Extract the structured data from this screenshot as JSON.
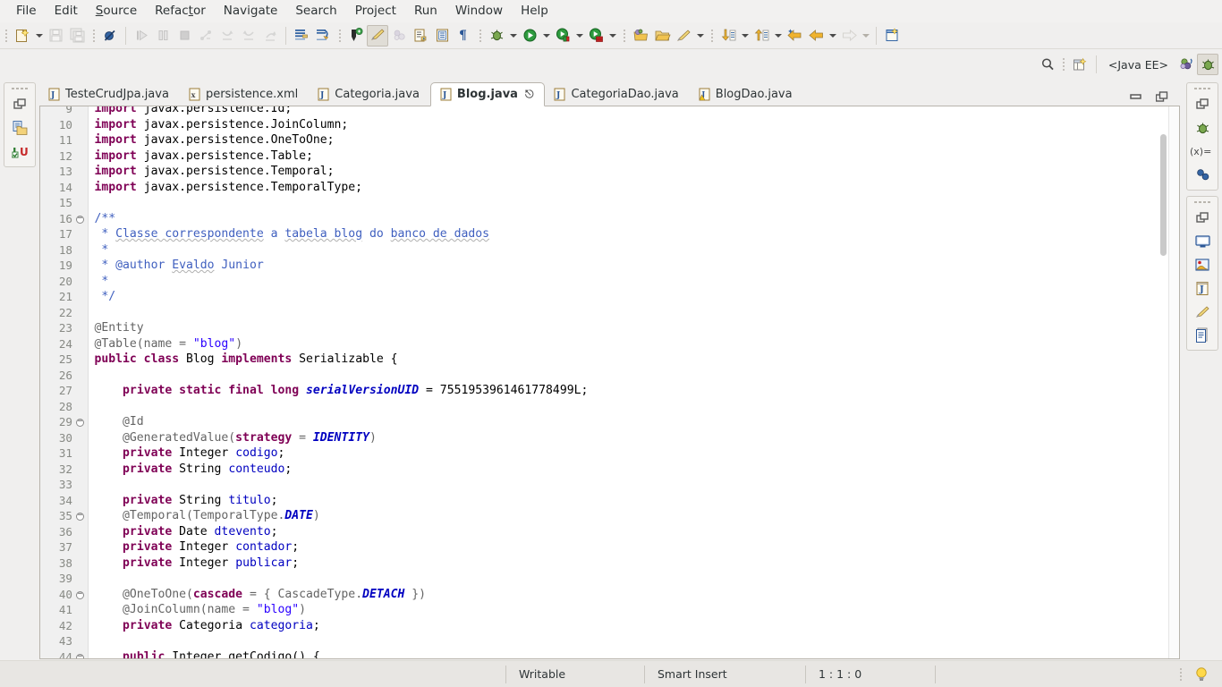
{
  "app": {
    "perspective_label": "<Java EE>",
    "accent_blue": "#2a00ff",
    "keyword_color": "#7f0055",
    "comment_color": "#3f5fbf",
    "field_color": "#0000c0",
    "annotation_color": "#646464"
  },
  "menubar": {
    "items": [
      {
        "label": "File",
        "mnemonic": ""
      },
      {
        "label": "Edit",
        "mnemonic": ""
      },
      {
        "label": "Source",
        "mnemonic": "S"
      },
      {
        "label": "Refactor",
        "mnemonic": "t"
      },
      {
        "label": "Navigate",
        "mnemonic": ""
      },
      {
        "label": "Search",
        "mnemonic": ""
      },
      {
        "label": "Project",
        "mnemonic": ""
      },
      {
        "label": "Run",
        "mnemonic": ""
      },
      {
        "label": "Window",
        "mnemonic": ""
      },
      {
        "label": "Help",
        "mnemonic": ""
      }
    ]
  },
  "toolbar": {
    "groups": [
      {
        "name": "file-group",
        "buttons": [
          {
            "icon": "new-wizard-icon",
            "enabled": true,
            "dropdown": true
          },
          {
            "icon": "save-icon",
            "enabled": false,
            "dropdown": false
          },
          {
            "icon": "save-all-icon",
            "enabled": false,
            "dropdown": false
          }
        ]
      },
      {
        "name": "annotation-group",
        "buttons": [
          {
            "icon": "skip-all-breakpoints-icon",
            "enabled": true,
            "dropdown": false
          }
        ]
      },
      {
        "name": "debug-control-group",
        "buttons": [
          {
            "icon": "resume-icon",
            "enabled": false,
            "dropdown": false
          },
          {
            "icon": "suspend-icon",
            "enabled": false,
            "dropdown": false
          },
          {
            "icon": "terminate-icon",
            "enabled": false,
            "dropdown": false
          },
          {
            "icon": "disconnect-icon",
            "enabled": false,
            "dropdown": false
          },
          {
            "icon": "step-into-icon",
            "enabled": false,
            "dropdown": false
          },
          {
            "icon": "step-over-icon",
            "enabled": false,
            "dropdown": false
          },
          {
            "icon": "step-return-icon",
            "enabled": false,
            "dropdown": false
          }
        ]
      },
      {
        "name": "navigate-group",
        "buttons": [
          {
            "icon": "next-annotation-icon",
            "enabled": true,
            "dropdown": false
          },
          {
            "icon": "previous-annotation-icon",
            "enabled": true,
            "dropdown": false
          }
        ]
      },
      {
        "name": "java-tools-group",
        "buttons": [
          {
            "icon": "new-java-package-icon",
            "enabled": true,
            "dropdown": false
          },
          {
            "icon": "new-java-class-icon",
            "enabled": true,
            "dropdown": false,
            "pressed": true
          },
          {
            "icon": "external-tools-icon",
            "enabled": false,
            "dropdown": false
          },
          {
            "icon": "open-type-icon",
            "enabled": true,
            "dropdown": false
          },
          {
            "icon": "open-task-icon",
            "enabled": true,
            "dropdown": false
          },
          {
            "icon": "show-whitespace-icon",
            "enabled": true,
            "dropdown": false
          }
        ]
      },
      {
        "name": "run-group",
        "buttons": [
          {
            "icon": "debug-icon",
            "enabled": true,
            "dropdown": true
          },
          {
            "icon": "run-icon",
            "enabled": true,
            "dropdown": true
          },
          {
            "icon": "run-on-server-icon",
            "enabled": true,
            "dropdown": true
          },
          {
            "icon": "debug-on-server-icon",
            "enabled": true,
            "dropdown": true
          }
        ]
      },
      {
        "name": "perspective-group",
        "buttons": [
          {
            "icon": "open-perspective-icon",
            "enabled": true,
            "dropdown": false
          },
          {
            "icon": "open-folder-icon",
            "enabled": true,
            "dropdown": false
          },
          {
            "icon": "pencil-icon",
            "enabled": true,
            "dropdown": true
          }
        ]
      },
      {
        "name": "member-nav-group",
        "buttons": [
          {
            "icon": "next-member-icon",
            "enabled": true,
            "dropdown": true
          },
          {
            "icon": "previous-member-icon",
            "enabled": true,
            "dropdown": true
          },
          {
            "icon": "back-to-last-edit-icon",
            "enabled": true,
            "dropdown": false
          },
          {
            "icon": "back-icon",
            "enabled": true,
            "dropdown": true
          },
          {
            "icon": "forward-icon",
            "enabled": false,
            "dropdown": true
          }
        ]
      },
      {
        "name": "new-editor-group",
        "buttons": [
          {
            "icon": "new-editor-icon",
            "enabled": true,
            "dropdown": false
          }
        ]
      }
    ]
  },
  "toolbar2": {
    "search_icon": "search-icon",
    "quick_access_icon": "open-perspective-icon",
    "perspective": "<Java EE>",
    "perspective_buttons": [
      {
        "icon": "java-ee-perspective-icon"
      },
      {
        "icon": "debug-perspective-icon",
        "active": true
      }
    ]
  },
  "left_sidebar": {
    "stacks": [
      {
        "name": "explorer-fastview-stack",
        "items": [
          {
            "icon": "restore-icon"
          },
          {
            "icon": "project-explorer-icon"
          },
          {
            "icon": "junit-icon"
          }
        ]
      }
    ]
  },
  "right_sidebar": {
    "stacks": [
      {
        "name": "debug-fastview-stack",
        "items": [
          {
            "icon": "restore-icon"
          },
          {
            "icon": "debug-view-icon"
          },
          {
            "icon": "variables-view-icon"
          },
          {
            "icon": "breakpoints-view-icon"
          }
        ]
      },
      {
        "name": "outline-fastview-stack",
        "items": [
          {
            "icon": "restore-icon"
          },
          {
            "icon": "console-view-icon"
          },
          {
            "icon": "servers-view-icon"
          },
          {
            "icon": "javadoc-view-icon"
          },
          {
            "icon": "annotations-view-icon"
          },
          {
            "icon": "outline-view-icon"
          }
        ]
      }
    ]
  },
  "editor": {
    "tabs": [
      {
        "label": "TesteCrudJpa.java",
        "icon": "java-file-icon",
        "active": false,
        "closeable": false
      },
      {
        "label": "persistence.xml",
        "icon": "xml-file-icon",
        "active": false,
        "closeable": false
      },
      {
        "label": "Categoria.java",
        "icon": "java-file-icon",
        "active": false,
        "closeable": false
      },
      {
        "label": "Blog.java",
        "icon": "java-file-icon",
        "active": true,
        "closeable": true
      },
      {
        "label": "CategoriaDao.java",
        "icon": "java-file-icon",
        "active": false,
        "closeable": false
      },
      {
        "label": "BlogDao.java",
        "icon": "java-file-warning-icon",
        "active": false,
        "closeable": false
      }
    ],
    "controls": [
      {
        "icon": "minimize-icon"
      },
      {
        "icon": "maximize-icon"
      }
    ],
    "scrollbar": {
      "thumb_top_pct": 5,
      "thumb_height_pct": 22
    },
    "lines": [
      {
        "n": "9",
        "fold": false,
        "tokens": [
          {
            "t": "import ",
            "c": "kw"
          },
          {
            "t": "javax.persistence.Id;",
            "c": ""
          }
        ]
      },
      {
        "n": "10",
        "fold": false,
        "tokens": [
          {
            "t": "import ",
            "c": "kw"
          },
          {
            "t": "javax.persistence.JoinColumn;",
            "c": ""
          }
        ]
      },
      {
        "n": "11",
        "fold": false,
        "tokens": [
          {
            "t": "import ",
            "c": "kw"
          },
          {
            "t": "javax.persistence.OneToOne;",
            "c": ""
          }
        ]
      },
      {
        "n": "12",
        "fold": false,
        "tokens": [
          {
            "t": "import ",
            "c": "kw"
          },
          {
            "t": "javax.persistence.Table;",
            "c": ""
          }
        ]
      },
      {
        "n": "13",
        "fold": false,
        "tokens": [
          {
            "t": "import ",
            "c": "kw"
          },
          {
            "t": "javax.persistence.Temporal;",
            "c": ""
          }
        ]
      },
      {
        "n": "14",
        "fold": false,
        "tokens": [
          {
            "t": "import ",
            "c": "kw"
          },
          {
            "t": "javax.persistence.TemporalType;",
            "c": ""
          }
        ]
      },
      {
        "n": "15",
        "fold": false,
        "tokens": []
      },
      {
        "n": "16",
        "fold": true,
        "tokens": [
          {
            "t": "/**",
            "c": "cmt"
          }
        ]
      },
      {
        "n": "17",
        "fold": false,
        "tokens": [
          {
            "t": " * ",
            "c": "cmt"
          },
          {
            "t": "Classe correspondente",
            "c": "cmt spell"
          },
          {
            "t": " a ",
            "c": "cmt"
          },
          {
            "t": "tabela blog",
            "c": "cmt spell"
          },
          {
            "t": " do ",
            "c": "cmt"
          },
          {
            "t": "banco de dados",
            "c": "cmt spell"
          }
        ]
      },
      {
        "n": "18",
        "fold": false,
        "tokens": [
          {
            "t": " *",
            "c": "cmt"
          }
        ]
      },
      {
        "n": "19",
        "fold": false,
        "tokens": [
          {
            "t": " * @author ",
            "c": "cmt"
          },
          {
            "t": "Evaldo",
            "c": "cmt spell"
          },
          {
            "t": " Junior",
            "c": "cmt"
          }
        ]
      },
      {
        "n": "20",
        "fold": false,
        "tokens": [
          {
            "t": " *",
            "c": "cmt"
          }
        ]
      },
      {
        "n": "21",
        "fold": false,
        "tokens": [
          {
            "t": " */",
            "c": "cmt"
          }
        ]
      },
      {
        "n": "22",
        "fold": false,
        "tokens": []
      },
      {
        "n": "23",
        "fold": false,
        "tokens": [
          {
            "t": "@Entity",
            "c": "ann"
          }
        ]
      },
      {
        "n": "24",
        "fold": false,
        "tokens": [
          {
            "t": "@Table(name = ",
            "c": "ann"
          },
          {
            "t": "\"blog\"",
            "c": "str"
          },
          {
            "t": ")",
            "c": "ann"
          }
        ]
      },
      {
        "n": "25",
        "fold": false,
        "tokens": [
          {
            "t": "public class ",
            "c": "kw"
          },
          {
            "t": "Blog ",
            "c": ""
          },
          {
            "t": "implements ",
            "c": "kw"
          },
          {
            "t": "Serializable {",
            "c": ""
          }
        ]
      },
      {
        "n": "26",
        "fold": false,
        "tokens": []
      },
      {
        "n": "27",
        "fold": false,
        "tokens": [
          {
            "t": "    ",
            "c": ""
          },
          {
            "t": "private static final long ",
            "c": "kw"
          },
          {
            "t": "serialVersionUID",
            "c": "sfld"
          },
          {
            "t": " = 7551953961461778499L;",
            "c": ""
          }
        ]
      },
      {
        "n": "28",
        "fold": false,
        "tokens": []
      },
      {
        "n": "29",
        "fold": true,
        "tokens": [
          {
            "t": "    @Id",
            "c": "ann"
          }
        ]
      },
      {
        "n": "30",
        "fold": false,
        "tokens": [
          {
            "t": "    @GeneratedValue(",
            "c": "ann"
          },
          {
            "t": "strategy",
            "c": "kw"
          },
          {
            "t": " = ",
            "c": "ann"
          },
          {
            "t": "IDENTITY",
            "c": "sconst"
          },
          {
            "t": ")",
            "c": "ann"
          }
        ]
      },
      {
        "n": "31",
        "fold": false,
        "tokens": [
          {
            "t": "    ",
            "c": ""
          },
          {
            "t": "private ",
            "c": "kw"
          },
          {
            "t": "Integer ",
            "c": ""
          },
          {
            "t": "codigo",
            "c": "fld"
          },
          {
            "t": ";",
            "c": ""
          }
        ]
      },
      {
        "n": "32",
        "fold": false,
        "tokens": [
          {
            "t": "    ",
            "c": ""
          },
          {
            "t": "private ",
            "c": "kw"
          },
          {
            "t": "String ",
            "c": ""
          },
          {
            "t": "conteudo",
            "c": "fld"
          },
          {
            "t": ";",
            "c": ""
          }
        ]
      },
      {
        "n": "33",
        "fold": false,
        "tokens": []
      },
      {
        "n": "34",
        "fold": false,
        "tokens": [
          {
            "t": "    ",
            "c": ""
          },
          {
            "t": "private ",
            "c": "kw"
          },
          {
            "t": "String ",
            "c": ""
          },
          {
            "t": "titulo",
            "c": "fld"
          },
          {
            "t": ";",
            "c": ""
          }
        ]
      },
      {
        "n": "35",
        "fold": true,
        "tokens": [
          {
            "t": "    @Temporal(TemporalType.",
            "c": "ann"
          },
          {
            "t": "DATE",
            "c": "sconst"
          },
          {
            "t": ")",
            "c": "ann"
          }
        ]
      },
      {
        "n": "36",
        "fold": false,
        "tokens": [
          {
            "t": "    ",
            "c": ""
          },
          {
            "t": "private ",
            "c": "kw"
          },
          {
            "t": "Date ",
            "c": ""
          },
          {
            "t": "dtevento",
            "c": "fld"
          },
          {
            "t": ";",
            "c": ""
          }
        ]
      },
      {
        "n": "37",
        "fold": false,
        "tokens": [
          {
            "t": "    ",
            "c": ""
          },
          {
            "t": "private ",
            "c": "kw"
          },
          {
            "t": "Integer ",
            "c": ""
          },
          {
            "t": "contador",
            "c": "fld"
          },
          {
            "t": ";",
            "c": ""
          }
        ]
      },
      {
        "n": "38",
        "fold": false,
        "tokens": [
          {
            "t": "    ",
            "c": ""
          },
          {
            "t": "private ",
            "c": "kw"
          },
          {
            "t": "Integer ",
            "c": ""
          },
          {
            "t": "publicar",
            "c": "fld"
          },
          {
            "t": ";",
            "c": ""
          }
        ]
      },
      {
        "n": "39",
        "fold": false,
        "tokens": []
      },
      {
        "n": "40",
        "fold": true,
        "tokens": [
          {
            "t": "    @OneToOne(",
            "c": "ann"
          },
          {
            "t": "cascade",
            "c": "kw"
          },
          {
            "t": " = { CascadeType.",
            "c": "ann"
          },
          {
            "t": "DETACH",
            "c": "sconst"
          },
          {
            "t": " })",
            "c": "ann"
          }
        ]
      },
      {
        "n": "41",
        "fold": false,
        "tokens": [
          {
            "t": "    @JoinColumn(name = ",
            "c": "ann"
          },
          {
            "t": "\"blog\"",
            "c": "str"
          },
          {
            "t": ")",
            "c": "ann"
          }
        ]
      },
      {
        "n": "42",
        "fold": false,
        "tokens": [
          {
            "t": "    ",
            "c": ""
          },
          {
            "t": "private ",
            "c": "kw"
          },
          {
            "t": "Categoria ",
            "c": ""
          },
          {
            "t": "categoria",
            "c": "fld"
          },
          {
            "t": ";",
            "c": ""
          }
        ]
      },
      {
        "n": "43",
        "fold": false,
        "tokens": []
      },
      {
        "n": "44",
        "fold": true,
        "tokens": [
          {
            "t": "    ",
            "c": ""
          },
          {
            "t": "public ",
            "c": "kw"
          },
          {
            "t": "Integer getCodigo() {",
            "c": ""
          }
        ]
      }
    ]
  },
  "statusbar": {
    "cells": [
      {
        "name": "editable-state",
        "label": "Writable"
      },
      {
        "name": "insert-mode",
        "label": "Smart Insert"
      },
      {
        "name": "cursor-position",
        "label": "1 : 1 : 0"
      }
    ],
    "tip_icon": "lightbulb-icon"
  }
}
